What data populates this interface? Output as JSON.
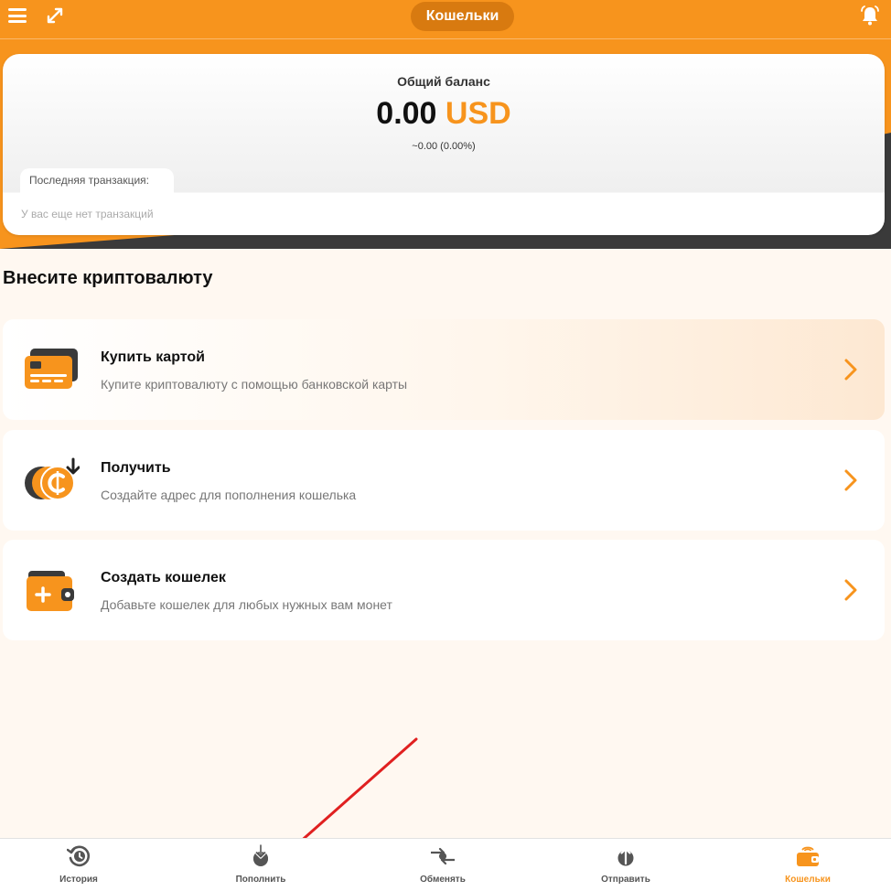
{
  "header": {
    "title": "Кошельки",
    "menu_icon": "hamburger-icon",
    "expand_icon": "expand-icon",
    "bell_icon": "bell-icon"
  },
  "balance": {
    "label": "Общий баланс",
    "amount": "0.00",
    "currency": "USD",
    "change": "~0.00 (0.00%)",
    "last_tx_label": "Последняя транзакция:",
    "no_tx_text": "У вас еще нет транзакций"
  },
  "section": {
    "title": "Внесите криптовалюту",
    "cards": [
      {
        "title": "Купить картой",
        "desc": "Купите криптовалюту с помощью банковской карты",
        "icon": "credit-card-icon"
      },
      {
        "title": "Получить",
        "desc": "Создайте адрес для пополнения кошелька",
        "icon": "receive-coins-icon"
      },
      {
        "title": "Создать кошелек",
        "desc": "Добавьте кошелек для любых нужных вам монет",
        "icon": "add-wallet-icon"
      }
    ]
  },
  "nav": {
    "items": [
      {
        "label": "История",
        "icon": "history-icon"
      },
      {
        "label": "Пополнить",
        "icon": "deposit-icon"
      },
      {
        "label": "Обменять",
        "icon": "exchange-icon"
      },
      {
        "label": "Отправить",
        "icon": "send-icon"
      },
      {
        "label": "Кошельки",
        "icon": "wallet-icon"
      }
    ],
    "active_index": 4
  },
  "colors": {
    "accent": "#f7941d",
    "dark": "#3a3a3a",
    "annotation": "#e02020"
  }
}
